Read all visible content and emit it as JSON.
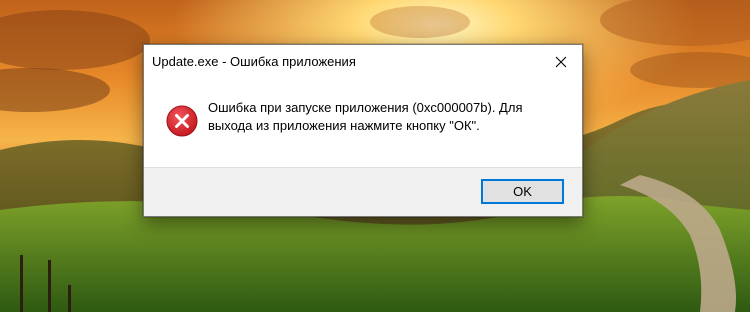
{
  "dialog": {
    "title": "Update.exe - Ошибка приложения",
    "message": "Ошибка при запуске приложения (0xc000007b). Для выхода из приложения нажмите кнопку \"ОК\".",
    "icon": "error-icon",
    "ok_label": "OK",
    "close_icon": "close-icon"
  },
  "colors": {
    "accent_border": "#0078d7",
    "error_red": "#d41f26",
    "footer_bg": "#f0f0f0"
  }
}
